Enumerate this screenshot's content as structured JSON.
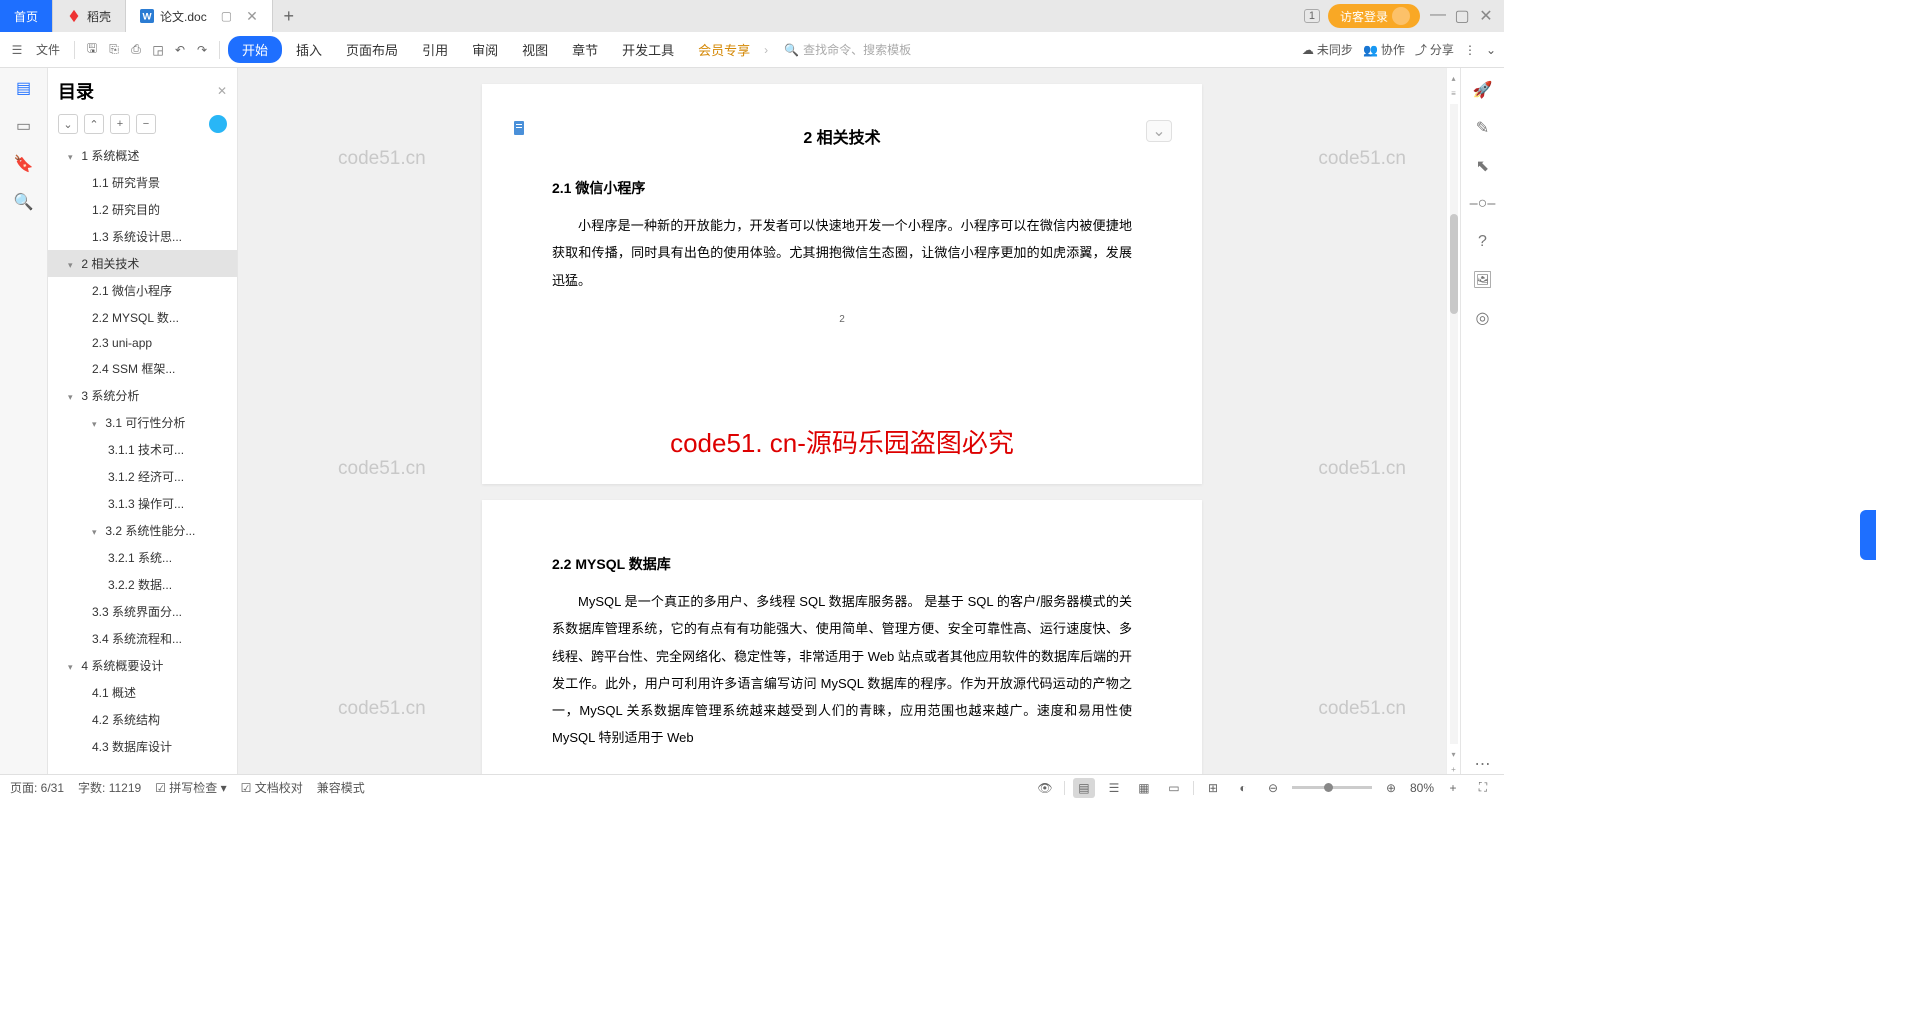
{
  "tabs": {
    "home": "首页",
    "docer": "稻壳",
    "doc": "论文.doc"
  },
  "titlebar": {
    "badge": "1",
    "login": "访客登录"
  },
  "toolbar": {
    "file": "文件",
    "menus": [
      "开始",
      "插入",
      "页面布局",
      "引用",
      "审阅",
      "视图",
      "章节",
      "开发工具",
      "会员专享"
    ],
    "search_placeholder": "查找命令、搜索模板",
    "sync": "未同步",
    "collab": "协作",
    "share": "分享"
  },
  "outline": {
    "title": "目录",
    "items": [
      {
        "l": 0,
        "chev": "▾",
        "t": "1 系统概述"
      },
      {
        "l": 1,
        "t": "1.1 研究背景"
      },
      {
        "l": 1,
        "t": "1.2 研究目的"
      },
      {
        "l": 1,
        "t": "1.3 系统设计思..."
      },
      {
        "l": 0,
        "chev": "▾",
        "t": "2 相关技术",
        "sel": true
      },
      {
        "l": 1,
        "t": "2.1 微信小程序"
      },
      {
        "l": 1,
        "t": "2.2 MYSQL 数..."
      },
      {
        "l": 1,
        "t": "2.3 uni-app"
      },
      {
        "l": 1,
        "t": "2.4 SSM 框架..."
      },
      {
        "l": 0,
        "chev": "▾",
        "t": "3 系统分析"
      },
      {
        "l": 1,
        "chev": "▾",
        "t": "3.1 可行性分析"
      },
      {
        "l": 2,
        "t": "3.1.1 技术可..."
      },
      {
        "l": 2,
        "t": "3.1.2 经济可..."
      },
      {
        "l": 2,
        "t": "3.1.3 操作可..."
      },
      {
        "l": 1,
        "chev": "▾",
        "t": "3.2 系统性能分..."
      },
      {
        "l": 2,
        "t": "3.2.1  系统..."
      },
      {
        "l": 2,
        "t": "3.2.2  数据..."
      },
      {
        "l": 1,
        "t": "3.3 系统界面分..."
      },
      {
        "l": 1,
        "t": "3.4 系统流程和..."
      },
      {
        "l": 0,
        "chev": "▾",
        "t": "4 系统概要设计"
      },
      {
        "l": 1,
        "t": "4.1 概述"
      },
      {
        "l": 1,
        "t": "4.2 系统结构"
      },
      {
        "l": 1,
        "t": "4.3 数据库设计"
      }
    ]
  },
  "document": {
    "page1": {
      "heading": "2 相关技术",
      "h3": "2.1 微信小程序",
      "p1": "小程序是一种新的开放能力，开发者可以快速地开发一个小程序。小程序可以在微信内被便捷地获取和传播，同时具有出色的使用体验。尤其拥抱微信生态圈，让微信小程序更加的如虎添翼，发展迅猛。",
      "num": "2"
    },
    "watermark": "code51. cn-源码乐园盗图必究",
    "wm_light": "code51.cn",
    "page2": {
      "h3": "2.2 MYSQL 数据库",
      "p1": "MySQL 是一个真正的多用户、多线程 SQL 数据库服务器。 是基于 SQL 的客户/服务器模式的关系数据库管理系统，它的有点有有功能强大、使用简单、管理方便、安全可靠性高、运行速度快、多线程、跨平台性、完全网络化、稳定性等，非常适用于 Web 站点或者其他应用软件的数据库后端的开发工作。此外，用户可利用许多语言编写访问 MySQL 数据库的程序。作为开放源代码运动的产物之一，MySQL 关系数据库管理系统越来越受到人们的青睐，应用范围也越来越广。速度和易用性使 MySQL 特别适用于 Web"
    }
  },
  "status": {
    "page": "页面: 6/31",
    "words": "字数: 11219",
    "spell": "拼写检查",
    "proof": "文档校对",
    "compat": "兼容模式",
    "zoom": "80%"
  }
}
